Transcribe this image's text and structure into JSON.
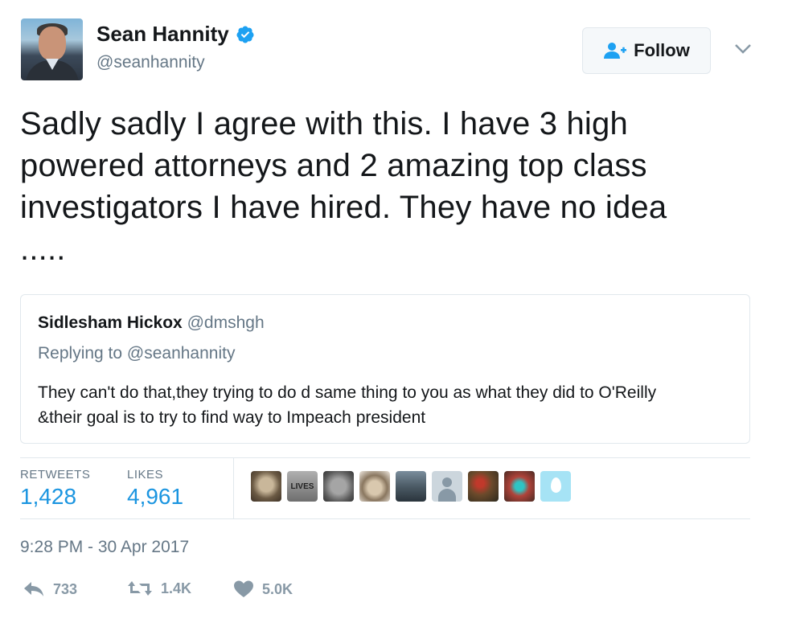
{
  "author": {
    "name": "Sean Hannity",
    "handle": "@seanhannity",
    "avatar_icon": "avatar-photo",
    "verified_icon": "verified-badge-icon",
    "verified_color": "#1da1f2"
  },
  "follow_button": {
    "label": "Follow",
    "icon": "follow-person-icon"
  },
  "tweet": {
    "text_lines": [
      "Sadly sadly I agree with this. I have 3 high",
      "powered attorneys and 2 amazing top class",
      "investigators I have hired. They have no idea",
      "....."
    ]
  },
  "quoted_tweet": {
    "name": "Sidlesham Hickox",
    "handle": "@dmshgh",
    "replying_to": "Replying to @seanhannity",
    "text_lines": [
      "They can't do that,they trying to do d same thing to you as what they did to O'Reilly",
      "&their goal is to try to find way to Impeach president"
    ]
  },
  "stats": {
    "retweets_label": "RETWEETS",
    "retweets_value": "1,428",
    "likes_label": "LIKES",
    "likes_value": "4,961",
    "accent_color": "#1b95e0"
  },
  "likers": [
    {
      "name": "liker-1",
      "icon": "avatar-photo"
    },
    {
      "name": "liker-2",
      "icon": "avatar-photo",
      "label": "LIVES"
    },
    {
      "name": "liker-3",
      "icon": "avatar-photo"
    },
    {
      "name": "liker-4",
      "icon": "avatar-photo"
    },
    {
      "name": "liker-5",
      "icon": "avatar-photo"
    },
    {
      "name": "liker-6",
      "icon": "default-avatar-icon"
    },
    {
      "name": "liker-7",
      "icon": "avatar-photo"
    },
    {
      "name": "liker-8",
      "icon": "avatar-photo"
    },
    {
      "name": "liker-9",
      "icon": "default-egg-avatar-icon"
    }
  ],
  "timestamp": "9:28 PM - 30 Apr 2017",
  "actions": {
    "reply": {
      "icon": "reply-icon",
      "count": "733"
    },
    "retweet": {
      "icon": "retweet-icon",
      "count": "1.4K"
    },
    "like": {
      "icon": "heart-icon",
      "count": "5.0K"
    }
  }
}
